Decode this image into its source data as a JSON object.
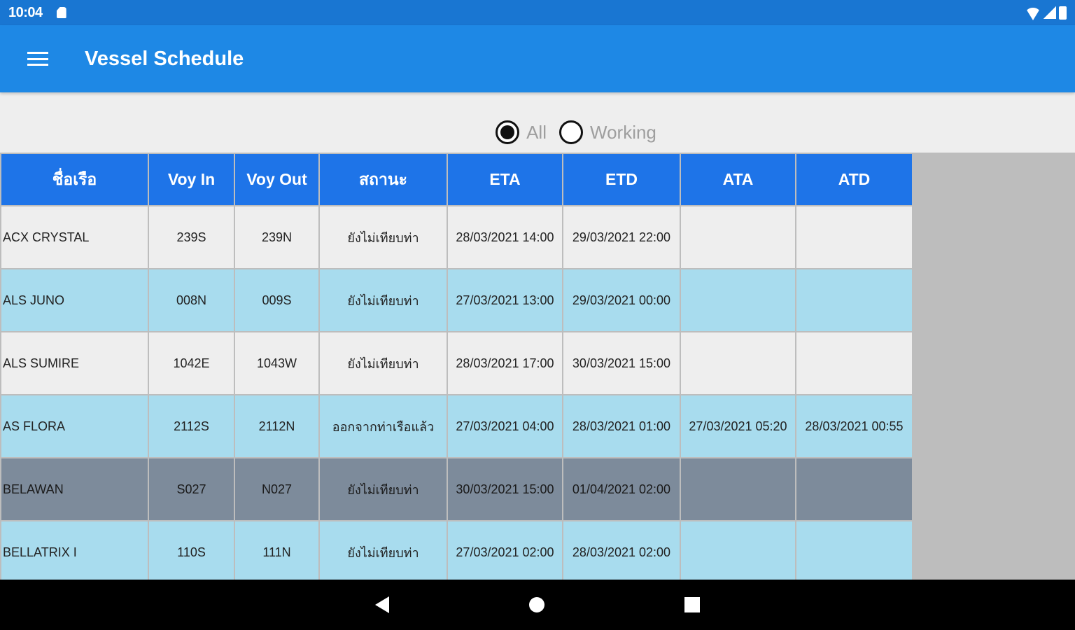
{
  "status_bar": {
    "time": "10:04"
  },
  "app_bar": {
    "title": "Vessel Schedule"
  },
  "filter": {
    "options": [
      {
        "label": "All",
        "selected": true
      },
      {
        "label": "Working",
        "selected": false
      }
    ]
  },
  "table": {
    "headers": [
      "ชื่อเรือ",
      "Voy In",
      "Voy Out",
      "สถานะ",
      "ETA",
      "ETD",
      "ATA",
      "ATD"
    ],
    "rows": [
      {
        "style": "light",
        "cells": [
          "ACX CRYSTAL",
          "239S",
          "239N",
          "ยังไม่เทียบท่า",
          "28/03/2021 14:00",
          "29/03/2021 22:00",
          "",
          ""
        ]
      },
      {
        "style": "blue",
        "cells": [
          "ALS JUNO",
          "008N",
          "009S",
          "ยังไม่เทียบท่า",
          "27/03/2021 13:00",
          "29/03/2021 00:00",
          "",
          ""
        ]
      },
      {
        "style": "light",
        "cells": [
          "ALS SUMIRE",
          "1042E",
          "1043W",
          "ยังไม่เทียบท่า",
          "28/03/2021 17:00",
          "30/03/2021 15:00",
          "",
          ""
        ]
      },
      {
        "style": "blue",
        "cells": [
          "AS FLORA",
          "2112S",
          "2112N",
          "ออกจากท่าเรือแล้ว",
          "27/03/2021 04:00",
          "28/03/2021 01:00",
          "27/03/2021 05:20",
          "28/03/2021 00:55"
        ]
      },
      {
        "style": "grey",
        "cells": [
          "BELAWAN",
          "S027",
          "N027",
          "ยังไม่เทียบท่า",
          "30/03/2021 15:00",
          "01/04/2021 02:00",
          "",
          ""
        ]
      },
      {
        "style": "blue",
        "cells": [
          "BELLATRIX I",
          "110S",
          "111N",
          "ยังไม่เทียบท่า",
          "27/03/2021 02:00",
          "28/03/2021 02:00",
          "",
          ""
        ]
      }
    ]
  },
  "colors": {
    "status_bar": "#1976d2",
    "app_bar": "#1e88e5",
    "header": "#1e74e8",
    "row_light": "#eeeeee",
    "row_blue": "#a8dcee",
    "row_grey": "#7d8b9b"
  },
  "icons": [
    "menu-icon",
    "sd-card-icon",
    "wifi-icon",
    "signal-icon",
    "battery-icon",
    "back-icon",
    "home-icon",
    "recents-icon"
  ]
}
